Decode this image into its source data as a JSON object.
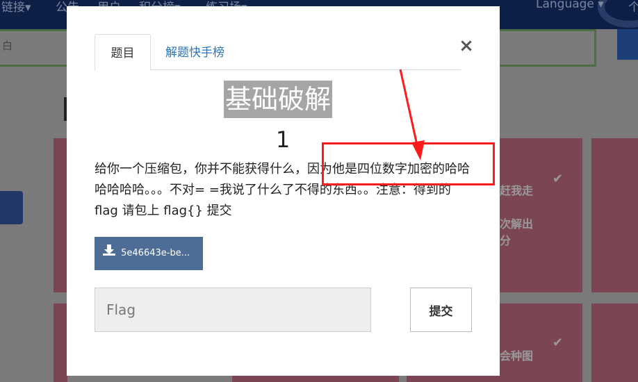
{
  "navbar": {
    "items": [
      "链接▾",
      "公告",
      "用户",
      "积分榜▾",
      "练习场▾"
    ],
    "language": "Language ▾",
    "right_trunc": "个"
  },
  "search": {
    "placeholder_fragment": "白"
  },
  "background_cards": [
    {
      "text": "赶我走"
    },
    {
      "text": "次解出\n分"
    },
    {
      "text": "会种图"
    }
  ],
  "modal": {
    "tabs": [
      {
        "label": "题目",
        "active": true
      },
      {
        "label": "解题快手榜",
        "active": false
      }
    ],
    "close_glyph": "×",
    "challenge_title": "基础破解",
    "score": "1",
    "description": "给你一个压缩包，你并不能获得什么，因为他是四位数字加密的哈哈哈哈哈哈。。。不对= =我说了什么了不得的东西。。注意：得到的 flag 请包上 flag{} 提交",
    "download_label": "5e46643e-be...",
    "flag_placeholder": "Flag",
    "submit_label": "提交"
  },
  "colors": {
    "annotation": "#ff1a1a",
    "tab_link": "#2a75c0",
    "download_button": "#4d6d96",
    "overlay_card": "#7b4553"
  }
}
